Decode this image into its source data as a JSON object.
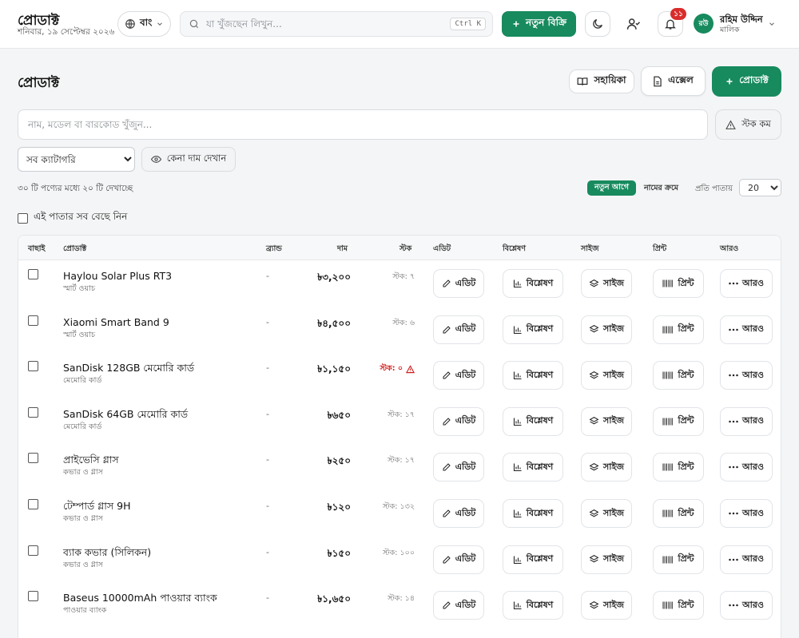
{
  "header": {
    "title": "প্রোডাক্ট",
    "date": "শনিবার, ১৯ সেপ্টেম্বর ২০২৬",
    "language": "বাং",
    "search_placeholder": "যা খুঁজছেন লিখুন...",
    "shortcut": "Ctrl K",
    "new_sale_label": "নতুন বিক্রি",
    "notification_count": "১১",
    "user": {
      "initials": "রউ",
      "name": "রহিম উদ্দিন",
      "role": "মালিক"
    }
  },
  "page": {
    "title": "প্রোডাক্ট",
    "guide_label": "সহায়িকা",
    "excel_label": "এক্সেল",
    "add_label": "প্রোডাক্ট",
    "search_placeholder": "নাম, মডেল বা বারকোড খুঁজুন...",
    "low_stock_label": "স্টক কম",
    "category_selected": "সব ক্যাটাগরি",
    "cost_price_label": "কেনা দাম দেখান",
    "count_text": "৩০ টি পণ্যের মধ্যে ২০ টি দেখাচ্ছে",
    "sort_newest": "নতুন আগে",
    "sort_name": "নামের ক্রমে",
    "per_page_label": "প্রতি পাতায়",
    "per_page_value": "20",
    "select_all_label": "এই পাতার সব বেছে নিন"
  },
  "table": {
    "headers": {
      "select": "বাছাই",
      "product": "প্রোডাক্ট",
      "brand": "ব্র্যান্ড",
      "price": "দাম",
      "stock": "স্টক",
      "edit": "এডিট",
      "analysis": "বিশ্লেষণ",
      "size": "সাইজ",
      "print": "প্রিন্ট",
      "more": "আরও"
    },
    "actions": {
      "edit": "এডিট",
      "analysis": "বিশ্লেষণ",
      "size": "সাইজ",
      "print": "প্রিন্ট",
      "more": "আরও"
    },
    "rows": [
      {
        "name": "Haylou Solar Plus RT3",
        "category": "স্মার্ট ওয়াচ",
        "brand": "-",
        "price": "৳৩,২০০",
        "stock": "স্টক: ৭",
        "zero": false
      },
      {
        "name": "Xiaomi Smart Band 9",
        "category": "স্মার্ট ওয়াচ",
        "brand": "-",
        "price": "৳৪,৫০০",
        "stock": "স্টক: ৬",
        "zero": false
      },
      {
        "name": "SanDisk 128GB মেমোরি কার্ড",
        "category": "মেমোরি কার্ড",
        "brand": "-",
        "price": "৳১,১৫০",
        "stock": "স্টক: ০",
        "zero": true
      },
      {
        "name": "SanDisk 64GB মেমোরি কার্ড",
        "category": "মেমোরি কার্ড",
        "brand": "-",
        "price": "৳৬৫০",
        "stock": "স্টক: ১৭",
        "zero": false
      },
      {
        "name": "প্রাইভেসি গ্লাস",
        "category": "কভার ও গ্লাস",
        "brand": "-",
        "price": "৳২৫০",
        "stock": "স্টক: ১৭",
        "zero": false
      },
      {
        "name": "টেম্পার্ড গ্লাস 9H",
        "category": "কভার ও গ্লাস",
        "brand": "-",
        "price": "৳১২০",
        "stock": "স্টক: ১৩২",
        "zero": false
      },
      {
        "name": "ব্যাক কভার (সিলিকন)",
        "category": "কভার ও গ্লাস",
        "brand": "-",
        "price": "৳১৫০",
        "stock": "স্টক: ১০০",
        "zero": false
      },
      {
        "name": "Baseus 10000mAh পাওয়ার ব্যাংক",
        "category": "পাওয়ার ব্যাংক",
        "brand": "-",
        "price": "৳১,৬৫০",
        "stock": "স্টক: ১৪",
        "zero": false
      }
    ]
  },
  "colors": {
    "accent": "#178a5e",
    "danger": "#d11f1f"
  }
}
